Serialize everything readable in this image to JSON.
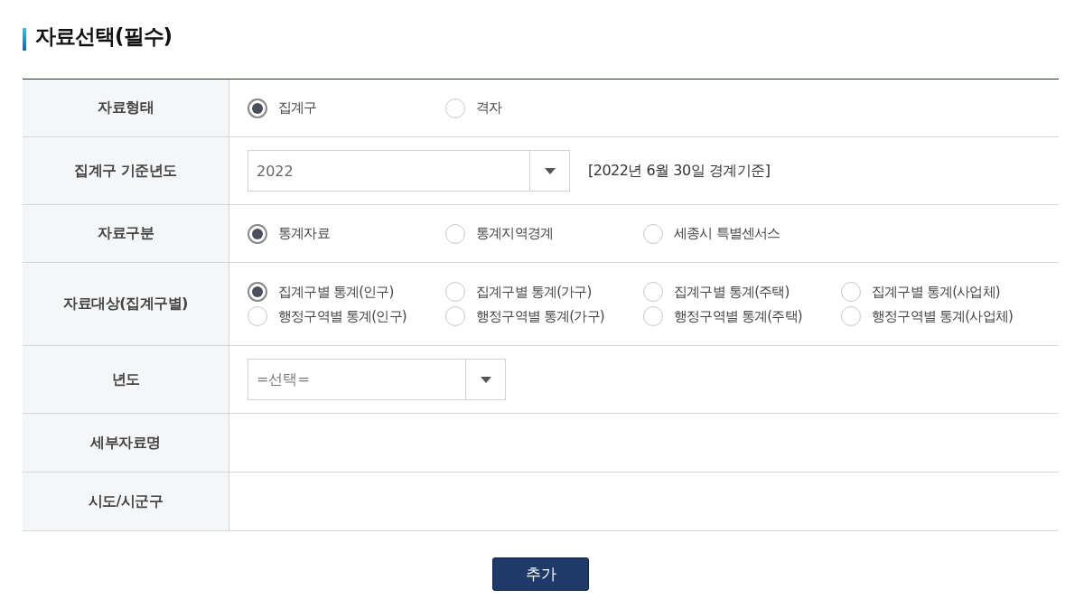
{
  "title": "자료선택(필수)",
  "rows": [
    {
      "label": "자료형태",
      "kind": "radio",
      "options": [
        {
          "label": "집계구",
          "selected": true
        },
        {
          "label": "격자",
          "selected": false
        }
      ]
    },
    {
      "label": "집계구 기준년도",
      "kind": "select",
      "select": {
        "value": "2022",
        "wide": true
      },
      "note": "[2022년 6월 30일 경계기준]"
    },
    {
      "label": "자료구분",
      "kind": "radio",
      "options": [
        {
          "label": "통계자료",
          "selected": true
        },
        {
          "label": "통계지역경계",
          "selected": false
        },
        {
          "label": "세종시 특별센서스",
          "selected": false
        }
      ]
    },
    {
      "label": "자료대상(집계구별)",
      "kind": "radio",
      "options": [
        {
          "label": "집계구별 통계(인구)",
          "selected": true
        },
        {
          "label": "집계구별 통계(가구)",
          "selected": false
        },
        {
          "label": "집계구별 통계(주택)",
          "selected": false
        },
        {
          "label": "집계구별 통계(사업체)",
          "selected": false
        },
        {
          "label": "행정구역별 통계(인구)",
          "selected": false
        },
        {
          "label": "행정구역별 통계(가구)",
          "selected": false
        },
        {
          "label": "행정구역별 통계(주택)",
          "selected": false
        },
        {
          "label": "행정구역별 통계(사업체)",
          "selected": false
        }
      ]
    },
    {
      "label": "년도",
      "kind": "select",
      "select": {
        "placeholder": "=선택=",
        "wide": false
      }
    },
    {
      "label": "세부자료명",
      "kind": "empty"
    },
    {
      "label": "시도/시군구",
      "kind": "empty"
    }
  ],
  "button": "추가"
}
